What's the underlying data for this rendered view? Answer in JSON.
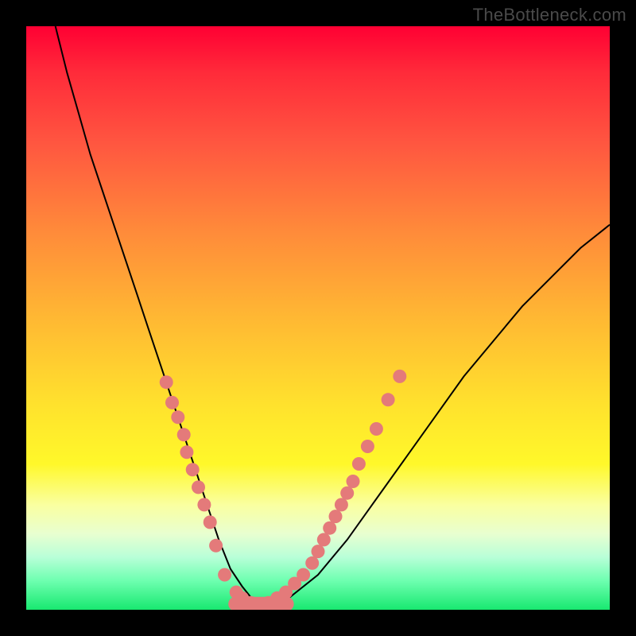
{
  "watermark": "TheBottleneck.com",
  "colors": {
    "frame": "#000000",
    "curve": "#000000",
    "marker": "#e47a7a",
    "gradient_top": "#ff0033",
    "gradient_bottom": "#18e870"
  },
  "chart_data": {
    "type": "line",
    "title": "",
    "xlabel": "",
    "ylabel": "",
    "xlim": [
      0,
      100
    ],
    "ylim": [
      0,
      100
    ],
    "annotations": [
      "TheBottleneck.com"
    ],
    "series": [
      {
        "name": "bottleneck-curve",
        "x": [
          5,
          7,
          9,
          11,
          13,
          15,
          17,
          19,
          21,
          23,
          25,
          27,
          29,
          31,
          33,
          35,
          37,
          39,
          41,
          45,
          50,
          55,
          60,
          65,
          70,
          75,
          80,
          85,
          90,
          95,
          100
        ],
        "y": [
          100,
          92,
          85,
          78,
          72,
          66,
          60,
          54,
          48,
          42,
          36,
          30,
          24,
          18,
          12,
          7,
          4,
          1.5,
          1,
          2,
          6,
          12,
          19,
          26,
          33,
          40,
          46,
          52,
          57,
          62,
          66
        ]
      }
    ],
    "markers": {
      "name": "highlighted-points",
      "points": [
        {
          "x": 24,
          "y": 39
        },
        {
          "x": 25,
          "y": 35.5
        },
        {
          "x": 26,
          "y": 33
        },
        {
          "x": 27,
          "y": 30
        },
        {
          "x": 27.5,
          "y": 27
        },
        {
          "x": 28.5,
          "y": 24
        },
        {
          "x": 29.5,
          "y": 21
        },
        {
          "x": 30.5,
          "y": 18
        },
        {
          "x": 31.5,
          "y": 15
        },
        {
          "x": 32.5,
          "y": 11
        },
        {
          "x": 34,
          "y": 6
        },
        {
          "x": 36,
          "y": 3
        },
        {
          "x": 37,
          "y": 2
        },
        {
          "x": 38.5,
          "y": 1.2
        },
        {
          "x": 40,
          "y": 1
        },
        {
          "x": 41.5,
          "y": 1.2
        },
        {
          "x": 43,
          "y": 2
        },
        {
          "x": 44.5,
          "y": 3
        },
        {
          "x": 46,
          "y": 4.5
        },
        {
          "x": 47.5,
          "y": 6
        },
        {
          "x": 49,
          "y": 8
        },
        {
          "x": 50,
          "y": 10
        },
        {
          "x": 51,
          "y": 12
        },
        {
          "x": 52,
          "y": 14
        },
        {
          "x": 53,
          "y": 16
        },
        {
          "x": 54,
          "y": 18
        },
        {
          "x": 55,
          "y": 20
        },
        {
          "x": 56,
          "y": 22
        },
        {
          "x": 57,
          "y": 25
        },
        {
          "x": 58.5,
          "y": 28
        },
        {
          "x": 60,
          "y": 31
        },
        {
          "x": 62,
          "y": 36
        },
        {
          "x": 64,
          "y": 40
        }
      ]
    }
  }
}
